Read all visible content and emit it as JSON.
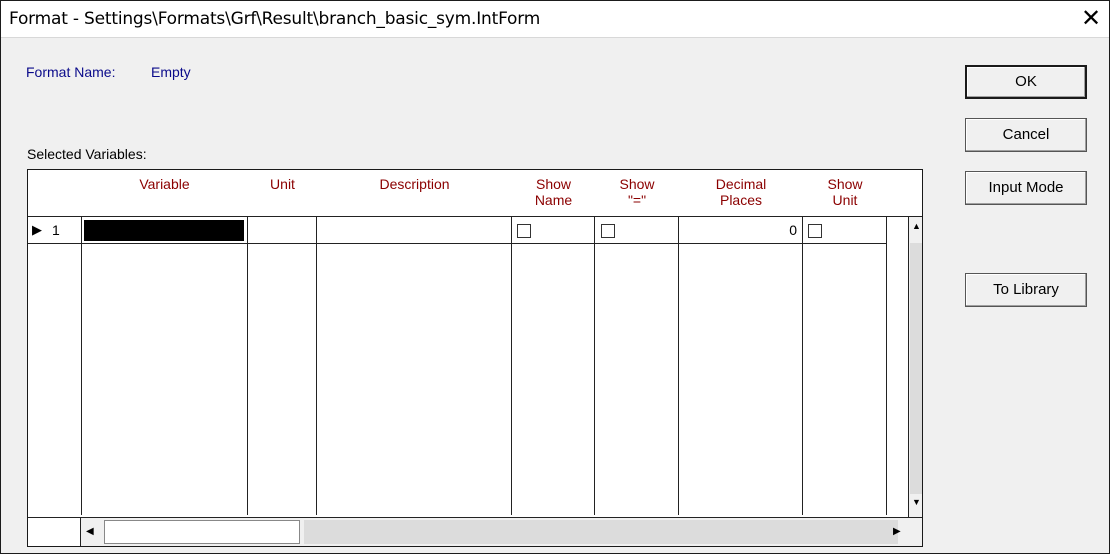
{
  "window": {
    "title": "Format - Settings\\Formats\\Grf\\Result\\branch_basic_sym.IntForm",
    "close_glyph": "✕"
  },
  "form": {
    "format_name_label": "Format Name:",
    "format_name_value": "Empty",
    "selected_variables_label": "Selected Variables:"
  },
  "buttons": {
    "ok": "OK",
    "cancel": "Cancel",
    "input_mode": "Input Mode",
    "to_library": "To Library"
  },
  "table": {
    "columns": [
      {
        "line1": "Variable",
        "line2": ""
      },
      {
        "line1": "Unit",
        "line2": ""
      },
      {
        "line1": "Description",
        "line2": ""
      },
      {
        "line1": "Show",
        "line2": "Name"
      },
      {
        "line1": "Show",
        "line2": "\"=\""
      },
      {
        "line1": "Decimal",
        "line2": "Places"
      },
      {
        "line1": "Show",
        "line2": "Unit"
      }
    ],
    "rows": [
      {
        "indicator": "▶",
        "number": "1",
        "variable": "",
        "unit": "",
        "description": "",
        "show_name": false,
        "show_equals": false,
        "decimal_places": "0",
        "show_unit": false
      }
    ]
  },
  "scrollbars": {
    "up_arrow": "▲",
    "down_arrow": "▼",
    "left_arrow": "◀",
    "right_arrow": "▶"
  },
  "colors": {
    "header_text": "#8b0000",
    "label_blue": "#0a0a8a",
    "selected_cell": "#000000"
  }
}
